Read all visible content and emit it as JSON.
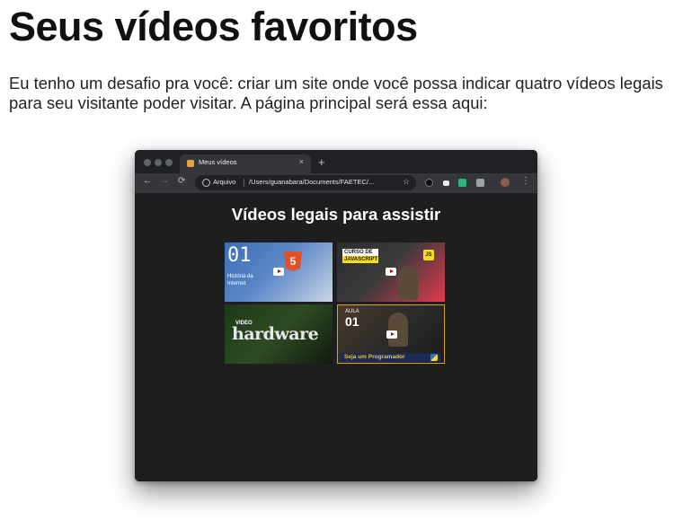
{
  "document": {
    "title": "Seus vídeos favoritos",
    "paragraph": "Eu tenho um desafio pra você: criar um site onde você possa indicar quatro vídeos legais para seu visitante poder visitar. A página principal será essa aqui:"
  },
  "browser": {
    "tab_title": "Meus vídeos",
    "tab_close": "×",
    "new_tab": "+",
    "nav": {
      "back": "←",
      "forward": "→",
      "reload": "⟳"
    },
    "omnibox": {
      "label": "Arquivo",
      "url": "/Users/guanabara/Documents/FAETEC/..."
    },
    "star": "☆",
    "menu": "⋮",
    "page": {
      "heading": "Vídeos legais para assistir",
      "thumbnails": [
        {
          "number": "01",
          "caption": "História da Internet",
          "badge": "5"
        },
        {
          "line1": "CURSO DE",
          "line2": "JAVASCRIPT",
          "badge": "JS"
        },
        {
          "small": "VIDEO",
          "title": "hardware"
        },
        {
          "label": "AULA",
          "number": "01",
          "banner": "Seja um Programador"
        }
      ]
    }
  },
  "colors": {
    "browser_frame": "#202124",
    "toolbar": "#35363a",
    "viewport": "#1e1e1e",
    "javascript_yellow": "#f7df1e",
    "html5_orange": "#e34f26"
  },
  "icons": [
    "back-arrow-icon",
    "forward-arrow-icon",
    "reload-icon",
    "info-icon",
    "star-icon",
    "menu-icon",
    "play-icon",
    "python-icon"
  ]
}
